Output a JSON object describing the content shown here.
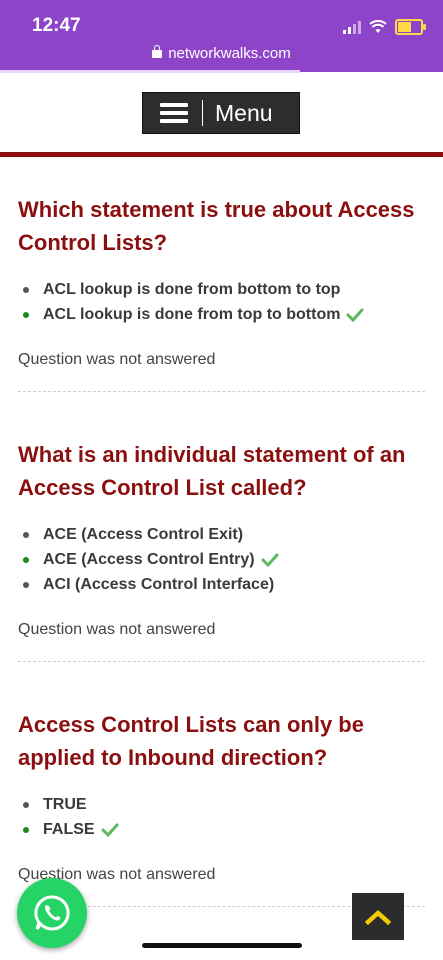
{
  "status": {
    "time": "12:47"
  },
  "browser": {
    "url": "networkwalks.com"
  },
  "nav": {
    "menu_label": "Menu"
  },
  "questions": [
    {
      "title": "Which statement is true about Access Control Lists?",
      "options": [
        {
          "label": "ACL lookup is done from bottom to top",
          "correct": false
        },
        {
          "label": "ACL lookup is done from top to bottom",
          "correct": true
        }
      ],
      "note": "Question was not answered"
    },
    {
      "title": "What is an individual statement of an Access Control List called?",
      "options": [
        {
          "label": "ACE (Access Control Exit)",
          "correct": false
        },
        {
          "label": "ACE (Access Control Entry)",
          "correct": true
        },
        {
          "label": "ACI (Access Control Interface)",
          "correct": false
        }
      ],
      "note": "Question was not answered"
    },
    {
      "title": "Access Control Lists can only be applied to Inbound direction?",
      "options": [
        {
          "label": "TRUE",
          "correct": false
        },
        {
          "label": "FALSE",
          "correct": true
        }
      ],
      "note": "Question was not answered"
    }
  ],
  "colors": {
    "header": "#8e44c9",
    "question_title": "#8b0f0f",
    "accent_line": "#8b1010",
    "correct": "#5cb85c",
    "whatsapp": "#25d366"
  },
  "icons": {
    "whatsapp": "whatsapp-icon",
    "scroll_top": "chevron-up-icon",
    "correct": "check-icon"
  }
}
